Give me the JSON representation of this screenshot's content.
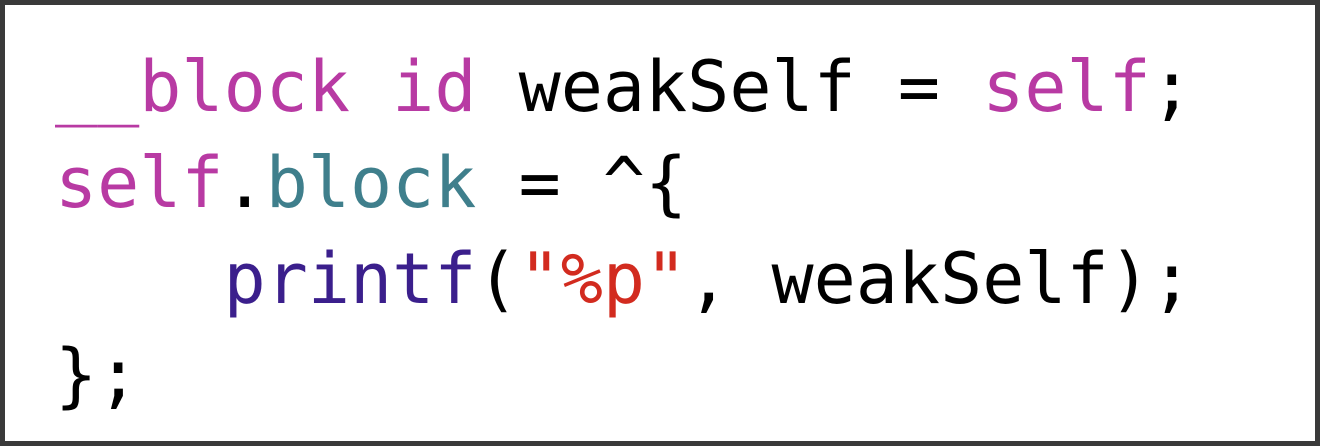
{
  "colors": {
    "keyword": "#b83aa3",
    "property": "#3f7f8c",
    "function": "#3b1f8c",
    "string": "#d22b1f",
    "plain": "#000000",
    "border": "#3a3a3a",
    "background": "#ffffff"
  },
  "code": {
    "line1": {
      "kw_block": "__block",
      "sp1": " ",
      "kw_id": "id",
      "var": " weakSelf = ",
      "kw_self": "self",
      "end": ";"
    },
    "line2": {
      "kw_self": "self",
      "dot": ".",
      "prop": "block",
      "rest": " = ^{"
    },
    "line3": {
      "indent": "    ",
      "fn": "printf",
      "open": "(",
      "str": "\"%p\"",
      "rest": ", weakSelf);"
    },
    "line4": {
      "text": "};"
    }
  }
}
